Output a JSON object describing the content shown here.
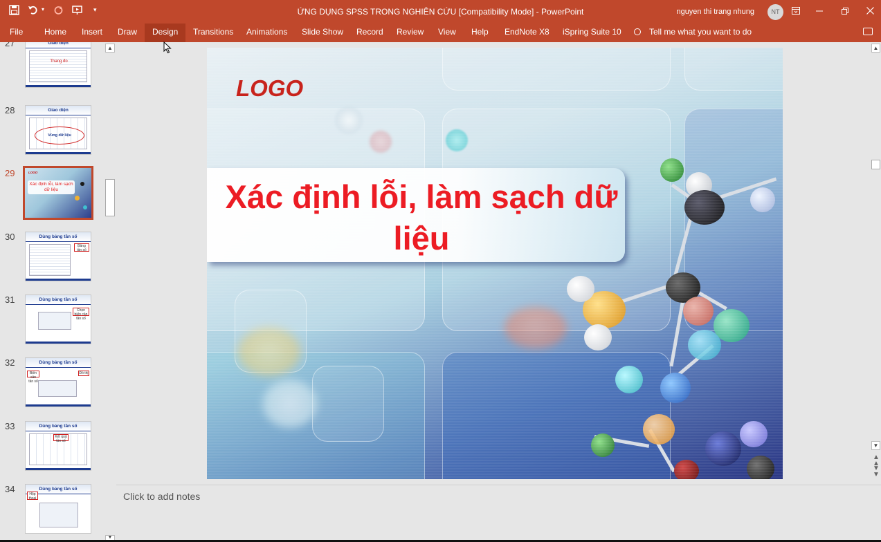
{
  "window": {
    "title": "ỨNG DỤNG SPSS TRONG NGHIÊN CỨU [Compatibility Mode]  -  PowerPoint",
    "user_name": "nguyen thi trang nhung",
    "user_initials": "NT",
    "accent_color": "#c0482c"
  },
  "quick_access": {
    "save_icon": "save-icon",
    "undo_icon": "undo-icon",
    "redo_icon": "redo-icon",
    "present_icon": "present-from-start-icon",
    "customize_icon": "customize-quick-access-icon"
  },
  "ribbon": {
    "tabs": [
      {
        "label": "File"
      },
      {
        "label": "Home"
      },
      {
        "label": "Insert"
      },
      {
        "label": "Draw"
      },
      {
        "label": "Design"
      },
      {
        "label": "Transitions"
      },
      {
        "label": "Animations"
      },
      {
        "label": "Slide Show"
      },
      {
        "label": "Record"
      },
      {
        "label": "Review"
      },
      {
        "label": "View"
      },
      {
        "label": "Help"
      },
      {
        "label": "EndNote X8"
      },
      {
        "label": "iSpring Suite 10"
      }
    ],
    "active_tab": "Design",
    "tell_me": "Tell me what you want to do"
  },
  "thumbnails": [
    {
      "number": "27",
      "heading": "Giao diện",
      "label": "Thang đo"
    },
    {
      "number": "28",
      "heading": "Giao diện",
      "label": "Vùng dữ liệu"
    },
    {
      "number": "29",
      "logo": "LOGO",
      "label": "Xác định lỗi, làm sạch dữ liệu"
    },
    {
      "number": "30",
      "heading": "Dùng bảng tần số",
      "callout": "Bảng tần số"
    },
    {
      "number": "31",
      "heading": "Dùng bảng tần số",
      "callout": "Chọn biến cần tần số"
    },
    {
      "number": "32",
      "heading": "Dùng bảng tần số",
      "callout_left": "Biến cần tần số",
      "callout_right": "Đồ thị"
    },
    {
      "number": "33",
      "heading": "Dùng bảng tần số",
      "callout": "Kết quả tần số"
    },
    {
      "number": "34",
      "heading": "Dùng bảng tần số",
      "callout": "Hộp thoại"
    }
  ],
  "selected_slide": "29",
  "slide": {
    "logo": "LOGO",
    "title": "Xác định lỗi, làm sạch dữ liệu",
    "title_color": "#ec1c24"
  },
  "notes": {
    "placeholder": "Click to add notes"
  }
}
